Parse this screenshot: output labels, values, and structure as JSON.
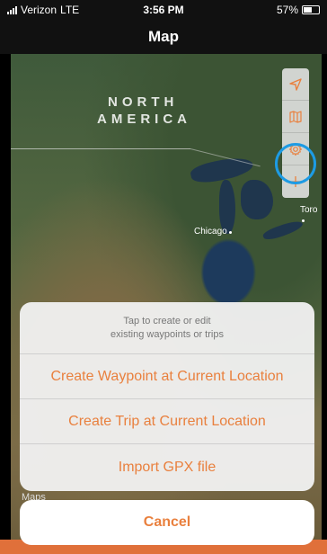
{
  "status_bar": {
    "carrier": "Verizon",
    "network": "LTE",
    "time": "3:56 PM",
    "battery": "57%",
    "battery_level": 0.57
  },
  "nav": {
    "title": "Map"
  },
  "map": {
    "region_label_line1": "NORTH",
    "region_label_line2": "AMERICA",
    "city_chicago": "Chicago",
    "city_toronto": "Toro",
    "credit": "Maps"
  },
  "controls": {
    "icons": [
      "location-arrow-icon",
      "map-icon",
      "gear-icon",
      "plus-icon"
    ],
    "highlight_color": "#1d9be4"
  },
  "action_sheet": {
    "header_line1": "Tap to create or edit",
    "header_line2": "existing waypoints or trips",
    "options": [
      "Create Waypoint at Current Location",
      "Create Trip at Current Location",
      "Import GPX file"
    ],
    "cancel_label": "Cancel",
    "accent_color": "#e9803e"
  }
}
